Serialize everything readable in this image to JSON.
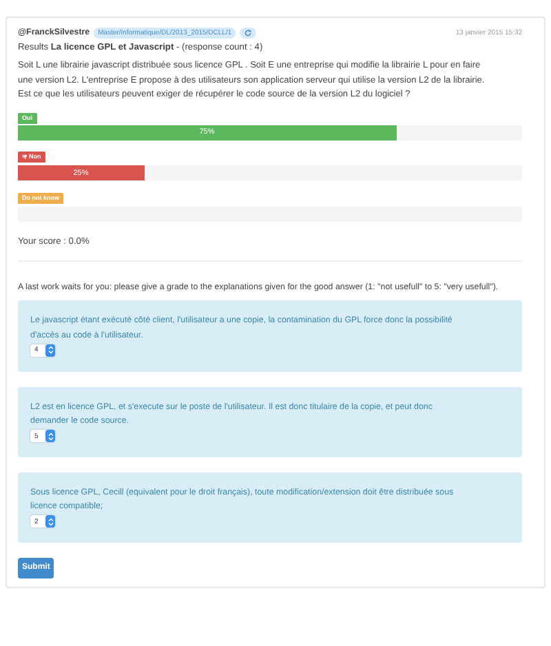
{
  "header": {
    "author": "@FranckSilvestre",
    "tag": "Master/Informatique/DL/2013_2015/DCLL/1",
    "date": "13 janvier 2015 15:32"
  },
  "results": {
    "prefix": "Results",
    "title": "La licence GPL et Javascript",
    "count": "- (response count : 4)"
  },
  "question": "Soit L une librairie javascript distribuée sous licence GPL . Soit E une entreprise qui modifie la librairie L pour en faire une version L2. L'entreprise E propose à des utilisateurs son application serveur qui utilise la version L2 de la librairie. Est ce que les utilisateurs peuvent exiger de récupérer le code source de la version L2 du logiciel ?",
  "answers": [
    {
      "label": "Oui",
      "kind": "yes",
      "level": 0.75,
      "reading": "75%"
    },
    {
      "label": "Non",
      "kind": "no",
      "level": 0.25,
      "reading": "25%"
    },
    {
      "label": "Do not know",
      "kind": "unknown",
      "level": 0
    }
  ],
  "score": "Your score : 0.0%",
  "grading_prompt": "A last work waits for you: please give a grade to the explanations given for the good answer (1: \"not usefull\" to 5: \"very usefull\").",
  "explanations": [
    {
      "text": "Le javascript étant exécuté côté client, l'utilisateur a une copie, la contamination du GPL force donc la possibilité d'accès au code à l'utilisateur.",
      "grade": "4"
    },
    {
      "text": "L2 est en licence GPL, et s'execute sur le poste de l'utilisateur. Il est donc titulaire de la copie, et peut donc demander le code source.",
      "grade": "5"
    },
    {
      "text": "Sous licence GPL, Cecill (equivalent pour le droit français), toute modification/extension doit être distribuée sous licence compatible;",
      "grade": "2"
    }
  ],
  "submit": "Submit"
}
